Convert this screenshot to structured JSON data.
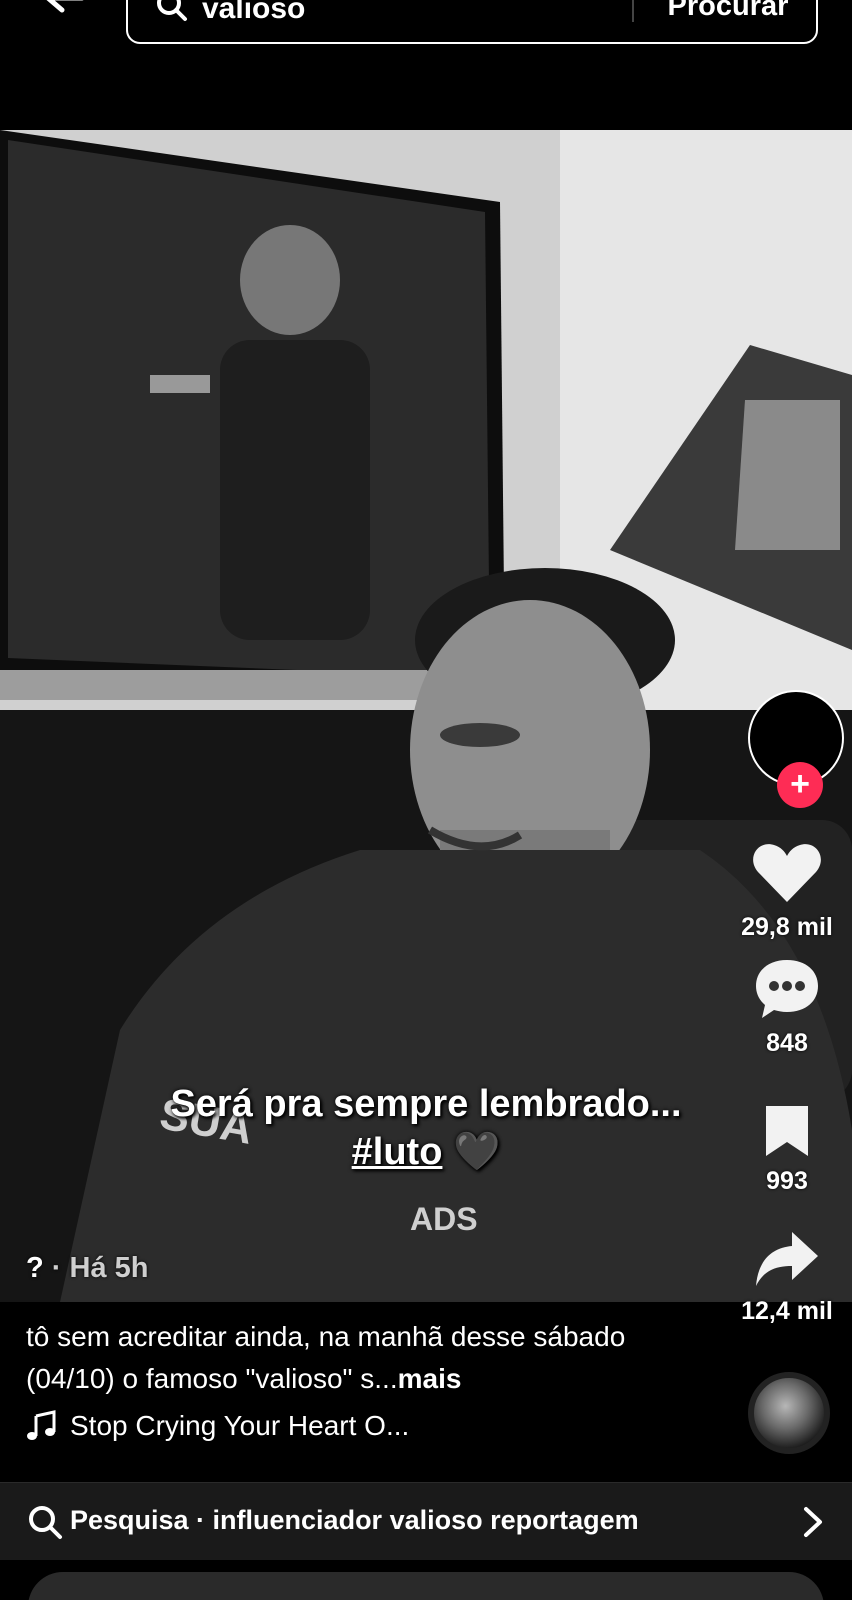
{
  "search": {
    "value": "valioso",
    "submit_label": "Procurar"
  },
  "video": {
    "overlay_line1": "Será pra sempre lembrado...",
    "overlay_hashtag": "#luto",
    "overlay_emoji": "🖤",
    "author_mark": "?",
    "timestamp": "· Há 5h"
  },
  "actions": {
    "likes": "29,8 mil",
    "comments": "848",
    "saves": "993",
    "shares": "12,4 mil"
  },
  "post": {
    "description": "tô sem acreditar ainda, na manhã desse sábado (04/10) o famoso \"valioso\" s...",
    "more_label": "mais",
    "music": "Stop Crying Your Heart O..."
  },
  "related": {
    "label": "Pesquisa · influenciador valioso reportagem"
  },
  "icons": [
    "back-arrow-icon",
    "search-icon",
    "heart-icon",
    "comment-icon",
    "bookmark-icon",
    "share-icon",
    "music-note-icon",
    "chevron-right-icon"
  ],
  "colors": {
    "follow": "#fe2c55",
    "background": "#000000"
  }
}
